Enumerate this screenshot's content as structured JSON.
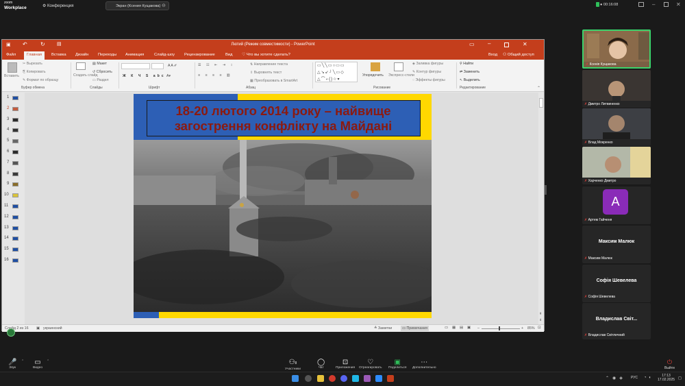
{
  "zoom": {
    "logo_top": "zoom",
    "logo_bottom": "Workplace",
    "conference_label": "Конференция",
    "share_label": "Экран (Ксения Кущакова)",
    "timer": "00:16:08",
    "buttons": [
      {
        "label": "Звук",
        "icon": "mic-muted-icon"
      },
      {
        "label": "Видео",
        "icon": "video-icon"
      },
      {
        "label": "Участники",
        "icon": "participants-icon",
        "count": "8"
      },
      {
        "label": "Чат",
        "icon": "chat-icon"
      },
      {
        "label": "Приложения",
        "icon": "apps-icon"
      },
      {
        "label": "Отреагировать",
        "icon": "react-icon"
      },
      {
        "label": "Поделиться",
        "icon": "share-icon"
      },
      {
        "label": "Дополнительно",
        "icon": "more-icon"
      }
    ],
    "leave_label": "Выйти"
  },
  "ppt": {
    "title": "Лютий  (Режим совместимости) - PowerPoint",
    "tabs": [
      "Файл",
      "Главная",
      "Вставка",
      "Дизайн",
      "Переходы",
      "Анимация",
      "Слайд-шоу",
      "Рецензирование",
      "Вид"
    ],
    "active_tab": "Главная",
    "tell_me": "Что вы хотите сделать?",
    "signin": "Вход",
    "share": "Общий доступ",
    "ribbon": {
      "paste": "Вставить",
      "cut": "Вырезать",
      "copy": "Копировать",
      "format_painter": "Формат по образцу",
      "clipboard": "Буфер обмена",
      "new_slide": "Создать слайд",
      "layout": "Макет",
      "reset": "Сбросить",
      "section": "Раздел",
      "slides": "Слайды",
      "font": "Шрифт",
      "text_direction": "Направление текста",
      "align_text": "Выровнять текст",
      "smartart": "Преобразовать в SmartArt",
      "paragraph": "Абзац",
      "arrange": "Упорядочить",
      "quick_styles": "Экспресс-стили",
      "shape_fill": "Заливка фигуры",
      "shape_outline": "Контур фигуры",
      "shape_effects": "Эффекты фигуры",
      "drawing": "Рисование",
      "find": "Найти",
      "replace": "Заменить",
      "select": "Выделить",
      "editing": "Редактирование"
    },
    "thumbnails": [
      "1",
      "2",
      "3",
      "4",
      "5",
      "6",
      "7",
      "8",
      "9",
      "10",
      "11",
      "12",
      "13",
      "14",
      "15",
      "16"
    ],
    "selected_thumbnail": "2",
    "slide_title_line1": "18-20 лютого 2014 року – найвище",
    "slide_title_line2": "загострення конфлікту на Майдані",
    "status": {
      "slide_of": "Слайд 2 из 16",
      "language": "украинский",
      "notes": "Заметки",
      "comments": "Примечания",
      "zoom": "85%"
    }
  },
  "gallery": [
    {
      "name": "Ксенія Кущакова",
      "type": "video",
      "speaking": true
    },
    {
      "name": "Дмитро Литвиненко",
      "type": "video"
    },
    {
      "name": "Влад Мокренко",
      "type": "video"
    },
    {
      "name": "Харченко Дмитро",
      "type": "video"
    },
    {
      "name": "Артем Гайченя",
      "type": "avatar",
      "initial": "А"
    },
    {
      "name": "Максим Малюк",
      "type": "name"
    },
    {
      "name": "Софія Шевелева",
      "type": "name"
    },
    {
      "name": "Владислав Світличний",
      "display": "Владислав Світ...",
      "type": "name"
    }
  ],
  "taskbar": {
    "time": "17:13",
    "date": "17.02.2025",
    "lang": "РУС"
  },
  "colors": {
    "ppt_accent": "#c43e1c",
    "slide_yellow": "#ffd800",
    "slide_blue": "#2d5fb5",
    "title_red": "#8b1a10",
    "avatar_purple": "#8a2bb8",
    "muted_red": "#e0403a"
  }
}
